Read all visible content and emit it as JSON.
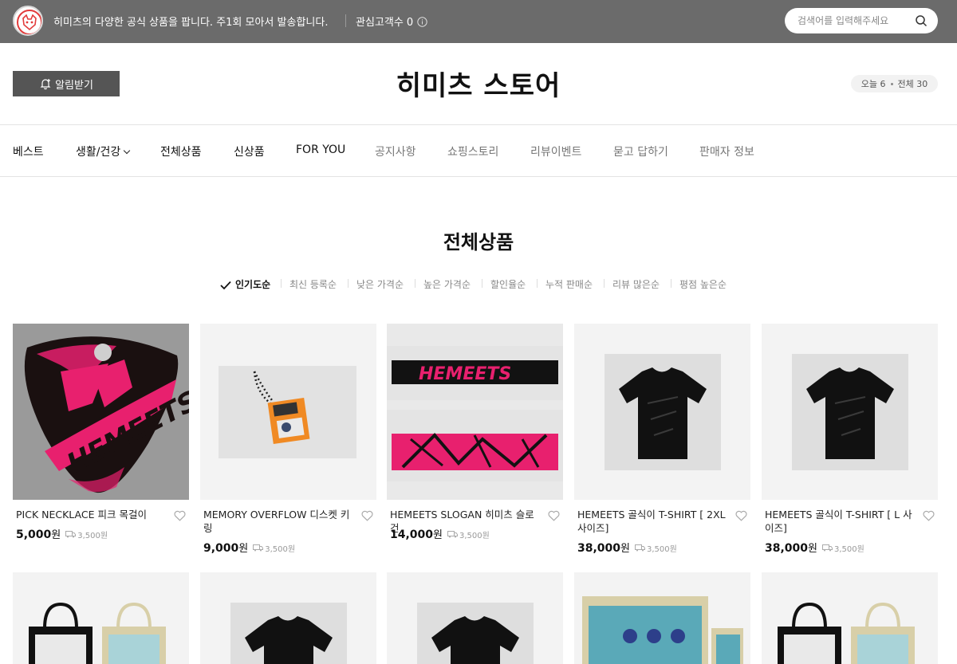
{
  "topbar": {
    "intro": "히미츠의 다양한 공식 상품을 팝니다. 주1회 모아서 발송합니다.",
    "follow_label": "관심고객수",
    "follow_count": "0",
    "search_placeholder": "검색어를 입력해주세요"
  },
  "header": {
    "notify_label": "알림받기",
    "store_title": "히미츠 스토어",
    "today_label": "오늘 6",
    "total_label": "전체 30"
  },
  "nav": {
    "items": [
      "베스트",
      "생활/건강",
      "전체상품",
      "신상품",
      "FOR YOU",
      "공지사항",
      "쇼핑스토리",
      "리뷰이벤트",
      "묻고 답하기",
      "판매자 정보"
    ]
  },
  "section": {
    "title": "전체상품"
  },
  "sort": {
    "options": [
      "인기도순",
      "최신 등록순",
      "낮은 가격순",
      "높은 가격순",
      "할인율순",
      "누적 판매순",
      "리뷰 많은순",
      "평점 높은순"
    ],
    "selected": "인기도순"
  },
  "products": [
    {
      "name": "PICK NECKLACE 피크 목걸이",
      "price": "5,000",
      "currency": "원",
      "shipping": "3,500원"
    },
    {
      "name": "MEMORY OVERFLOW 디스켓 키링",
      "price": "9,000",
      "currency": "원",
      "shipping": "3,500원"
    },
    {
      "name": "HEMEETS SLOGAN 히미츠 슬로건",
      "price": "14,000",
      "currency": "원",
      "shipping": "3,500원"
    },
    {
      "name": "HEMEETS 골식이 T-SHIRT [ 2XL 사이즈]",
      "price": "38,000",
      "currency": "원",
      "shipping": "3,500원"
    },
    {
      "name": "HEMEETS 골식이 T-SHIRT [ L 사이즈]",
      "price": "38,000",
      "currency": "원",
      "shipping": "3,500원"
    }
  ],
  "colors": {
    "topbar": "#6b6b6b",
    "button": "#555555",
    "accent_pink": "#e8206e"
  }
}
